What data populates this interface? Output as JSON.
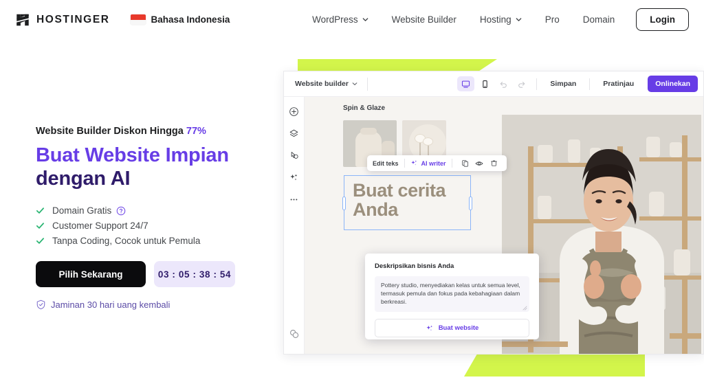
{
  "header": {
    "logo_text": "HOSTINGER",
    "logo_icon": "hostinger-h-logo",
    "language": {
      "label": "Bahasa Indonesia",
      "flag": "indonesia-flag"
    },
    "nav": [
      {
        "label": "WordPress",
        "has_caret": true
      },
      {
        "label": "Website Builder",
        "has_caret": false
      },
      {
        "label": "Hosting",
        "has_caret": true
      },
      {
        "label": "Pro",
        "has_caret": false
      },
      {
        "label": "Domain",
        "has_caret": false
      }
    ],
    "login_label": "Login"
  },
  "hero": {
    "eyebrow_text": "Website Builder Diskon Hingga ",
    "eyebrow_percent": "77%",
    "headline_line1": "Buat Website Impian",
    "headline_line2": "dengan AI",
    "features": [
      {
        "label": "Domain Gratis",
        "help_icon": "question-mark-icon"
      },
      {
        "label": "Customer Support 24/7",
        "help_icon": ""
      },
      {
        "label": "Tanpa Coding, Cocok untuk Pemula",
        "help_icon": ""
      }
    ],
    "cta_label": "Pilih Sekarang",
    "countdown": "03 : 05 : 38 : 54",
    "guarantee_label": "Jaminan 30 hari uang kembali",
    "guarantee_icon": "shield-check-icon"
  },
  "builder": {
    "topbar": {
      "title": "Website builder",
      "caret_icon": "chevron-down-icon",
      "desktop_icon": "desktop-monitor-icon",
      "mobile_icon": "mobile-phone-icon",
      "undo_icon": "undo-arrow-icon",
      "redo_icon": "redo-arrow-icon",
      "save_label": "Simpan",
      "preview_label": "Pratinjau",
      "publish_label": "Onlinekan"
    },
    "sidebar_icons": [
      "add-circle-icon",
      "layers-icon",
      "pointer-click-icon",
      "ai-sparkles-icon",
      "more-dots-icon",
      "help-bubbles-icon"
    ],
    "canvas": {
      "site_title": "Spin & Glaze",
      "thumbnail_1": "pottery-vases-image",
      "thumbnail_2": "dried-flowers-plate-image",
      "hero_photo": "potter-holding-bowl-image",
      "selected_text_line1": "Buat cerita",
      "selected_text_line2": "Anda"
    },
    "text_toolbar": {
      "edit_label": "Edit teks",
      "ai_writer_label": "AI writer",
      "ai_icon": "sparkles-icon",
      "duplicate_icon": "duplicate-icon",
      "visibility_icon": "eye-icon",
      "delete_icon": "trash-icon"
    },
    "ai_panel": {
      "title": "Deskripsikan bisnis Anda",
      "description_value": "Pottery studio, menyediakan kelas untuk semua level, termasuk pemula dan fokus pada kebahagiaan dalam berkreasi.",
      "button_label": "Buat website",
      "button_icon": "sparkles-icon"
    }
  },
  "colors": {
    "purple": "#673de6",
    "dark_purple": "#2f1c6a",
    "green_accent": "#d3f54b",
    "black": "#0b0b0d",
    "timer_bg": "#ece7fb",
    "tick_green": "#2bb573"
  }
}
